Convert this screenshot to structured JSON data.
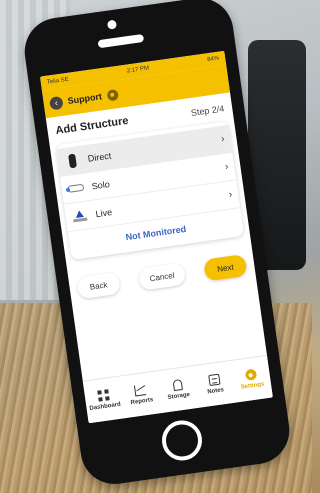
{
  "statusbar": {
    "carrier": "Telia SE",
    "time": "2:17 PM",
    "battery": "84%"
  },
  "header": {
    "title": "Support"
  },
  "page": {
    "title": "Add Structure",
    "step": "Step 2/4"
  },
  "options": [
    {
      "label": "Direct",
      "icon": "direct-sensor-icon",
      "selected": true
    },
    {
      "label": "Solo",
      "icon": "solo-sensor-icon",
      "selected": false
    },
    {
      "label": "Live",
      "icon": "live-sensor-icon",
      "selected": false
    }
  ],
  "not_monitored_label": "Not Monitored",
  "buttons": {
    "back": "Back",
    "cancel": "Cancel",
    "next": "Next"
  },
  "tabs": [
    {
      "label": "Dashboard",
      "icon": "dashboard-icon"
    },
    {
      "label": "Reports",
      "icon": "reports-icon"
    },
    {
      "label": "Storage",
      "icon": "storage-icon"
    },
    {
      "label": "Notes",
      "icon": "notes-icon"
    },
    {
      "label": "Settings",
      "icon": "settings-icon",
      "active": true
    }
  ],
  "colors": {
    "accent": "#f5c000",
    "link": "#3b65c4"
  }
}
